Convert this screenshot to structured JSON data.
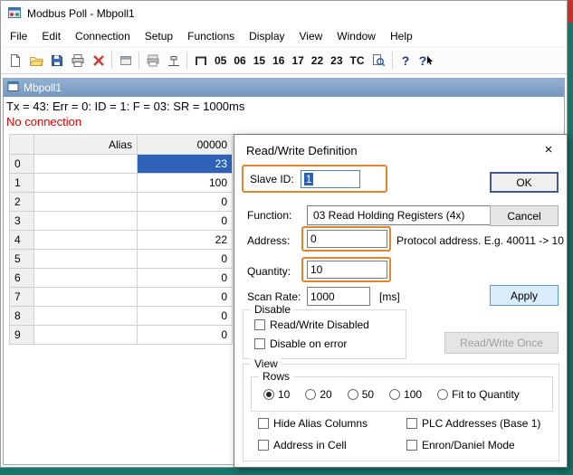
{
  "colors": {
    "annotation_orange": "#e8832a",
    "selection_blue": "#2e62b8",
    "no_connection_red": "#e60000",
    "desktop_teal": "#15766c",
    "desktop_red": "#c93128"
  },
  "titlebar": {
    "title": "Modbus Poll - Mbpoll1"
  },
  "menubar": {
    "items": [
      "File",
      "Edit",
      "Connection",
      "Setup",
      "Functions",
      "Display",
      "View",
      "Window",
      "Help"
    ]
  },
  "toolbar": {
    "icons": [
      "new-file",
      "open-folder",
      "save",
      "print",
      "disconnect",
      "setup-window",
      "print-preview",
      "comm-traffic",
      "junction",
      "find",
      "help",
      "context-help"
    ],
    "buttons": [
      "05",
      "06",
      "15",
      "16",
      "17",
      "22",
      "23",
      "TC"
    ]
  },
  "child_window": {
    "title": "Mbpoll1",
    "status_line": "Tx = 43: Err = 0: ID = 1: F = 03: SR = 1000ms",
    "connection_status": "No connection"
  },
  "grid": {
    "headers": {
      "row": "",
      "alias": "Alias",
      "value_col": "00000"
    },
    "rows": [
      {
        "num": "0",
        "alias": "",
        "value": "23"
      },
      {
        "num": "1",
        "alias": "",
        "value": "100"
      },
      {
        "num": "2",
        "alias": "",
        "value": "0"
      },
      {
        "num": "3",
        "alias": "",
        "value": "0"
      },
      {
        "num": "4",
        "alias": "",
        "value": "22"
      },
      {
        "num": "5",
        "alias": "",
        "value": "0"
      },
      {
        "num": "6",
        "alias": "",
        "value": "0"
      },
      {
        "num": "7",
        "alias": "",
        "value": "0"
      },
      {
        "num": "8",
        "alias": "",
        "value": "0"
      },
      {
        "num": "9",
        "alias": "",
        "value": "0"
      }
    ]
  },
  "dialog": {
    "title": "Read/Write Definition",
    "close_glyph": "×",
    "fields": {
      "slave_id": {
        "label": "Slave ID:",
        "value": "1"
      },
      "function": {
        "label": "Function:",
        "value": "03 Read Holding Registers (4x)"
      },
      "address": {
        "label": "Address:",
        "value": "0",
        "hint": "Protocol address. E.g. 40011 -> 10"
      },
      "quantity": {
        "label": "Quantity:",
        "value": "10"
      },
      "scan_rate": {
        "label": "Scan Rate:",
        "value": "1000",
        "unit": "[ms]"
      }
    },
    "buttons": {
      "ok": "OK",
      "cancel": "Cancel",
      "apply": "Apply",
      "read_write_once": "Read/Write Once"
    },
    "disable_group": {
      "legend": "Disable",
      "read_write_disabled": "Read/Write Disabled",
      "disable_on_error": "Disable on error"
    },
    "view_group": {
      "legend": "View",
      "rows_legend": "Rows",
      "rows_options": [
        "10",
        "20",
        "50",
        "100",
        "Fit to Quantity"
      ],
      "selected_rows": "10",
      "checkboxes": [
        "Hide Alias Columns",
        "PLC Addresses (Base 1)",
        "Address in Cell",
        "Enron/Daniel Mode"
      ]
    }
  }
}
